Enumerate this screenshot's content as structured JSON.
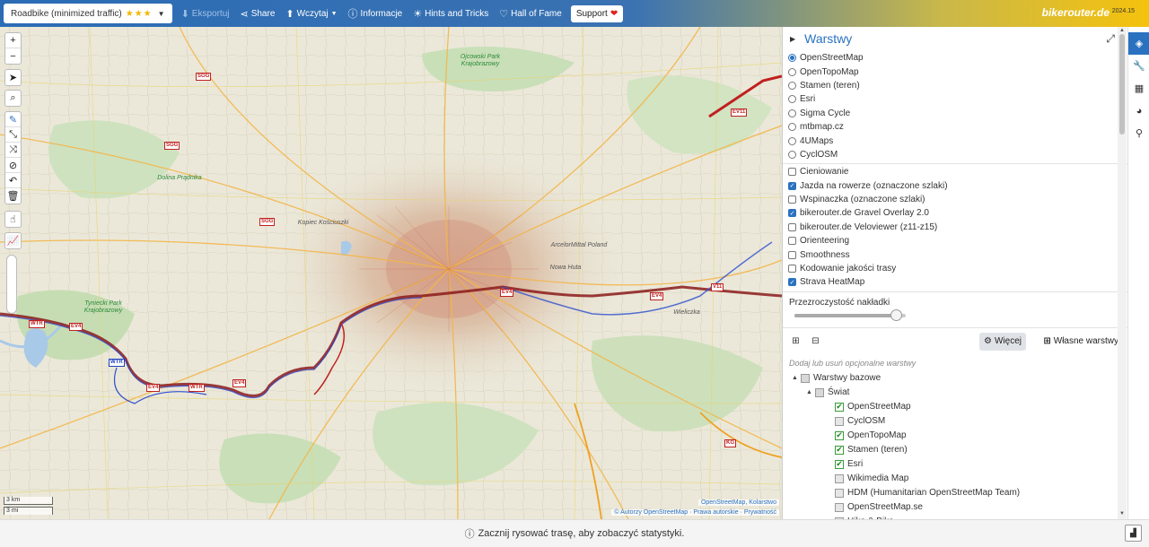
{
  "topbar": {
    "profile": "Roadbike (minimized traffic)",
    "profile_stars": "★★★",
    "export_label": "Eksportuj",
    "share_label": "Share",
    "load_label": "Wczytaj",
    "info_label": "Informacje",
    "hints_label": "Hints and Tricks",
    "fame_label": "Hall of Fame",
    "support_label": "Support",
    "brand": "bikerouter.de",
    "version": "2024.15"
  },
  "map": {
    "scale_km": "3 km",
    "scale_mi": "3 mi",
    "attribution_top": "OpenStreetMap, Kolarstwo",
    "attribution_bottom": "© Autorzy OpenStreetMap · Prawa autorskie · Prywatność",
    "places": [
      "Dolina Prądnika",
      "Ojcowski Park Krajobrazowy",
      "Tyniecki Park Krajobrazowy",
      "Kopiec Kościuszki",
      "Nowa Huta",
      "ArcelorMittal Poland",
      "Wieliczka"
    ],
    "route_labels": [
      "SGG",
      "SGG",
      "SGG",
      "EV4",
      "WTR",
      "WTR",
      "EV4",
      "WTR",
      "EV4",
      "EV4",
      "KG",
      "EV11",
      "V11",
      "EV4"
    ]
  },
  "sidebar": {
    "title": "Warstwy",
    "base_layers": [
      {
        "label": "OpenStreetMap",
        "checked": true
      },
      {
        "label": "OpenTopoMap",
        "checked": false
      },
      {
        "label": "Stamen (teren)",
        "checked": false
      },
      {
        "label": "Esri",
        "checked": false
      },
      {
        "label": "Sigma Cycle",
        "checked": false
      },
      {
        "label": "mtbmap.cz",
        "checked": false
      },
      {
        "label": "4UMaps",
        "checked": false
      },
      {
        "label": "CyclOSM",
        "checked": false
      }
    ],
    "overlays": [
      {
        "label": "Cieniowanie",
        "checked": false
      },
      {
        "label": "Jazda na rowerze (oznaczone szlaki)",
        "checked": true
      },
      {
        "label": "Wspinaczka (oznaczone szlaki)",
        "checked": false
      },
      {
        "label": "bikerouter.de Gravel Overlay 2.0",
        "checked": true
      },
      {
        "label": "bikerouter.de Veloviewer (z11-z15)",
        "checked": false
      },
      {
        "label": "Orienteering",
        "checked": false
      },
      {
        "label": "Smoothness",
        "checked": false
      },
      {
        "label": "Kodowanie jakości trasy",
        "checked": false
      },
      {
        "label": "Strava HeatMap",
        "checked": true
      }
    ],
    "opacity_label": "Przezroczystość nakładki",
    "opacity_value": 0.92,
    "more_label": "Więcej",
    "custom_label": "Własne warstwy",
    "hint": "Dodaj lub usuń opcjonalne warstwy",
    "tree_root": "Warstwy bazowe",
    "tree_group": "Świat",
    "tree_items": [
      {
        "label": "OpenStreetMap",
        "checked": true
      },
      {
        "label": "CyclOSM",
        "checked": false
      },
      {
        "label": "OpenTopoMap",
        "checked": true
      },
      {
        "label": "Stamen (teren)",
        "checked": true
      },
      {
        "label": "Esri",
        "checked": true
      },
      {
        "label": "Wikimedia Map",
        "checked": false
      },
      {
        "label": "HDM (Humanitarian OpenStreetMap Team)",
        "checked": false
      },
      {
        "label": "OpenStreetMap.se",
        "checked": false
      },
      {
        "label": "Hike & Bike",
        "checked": false
      }
    ]
  },
  "footer": {
    "message": "Zacznij rysować trasę, aby zobaczyć statystyki."
  },
  "colors": {
    "accent": "#2a72c0",
    "route_red": "#8b1a1a",
    "route_blue": "#2040c0"
  }
}
